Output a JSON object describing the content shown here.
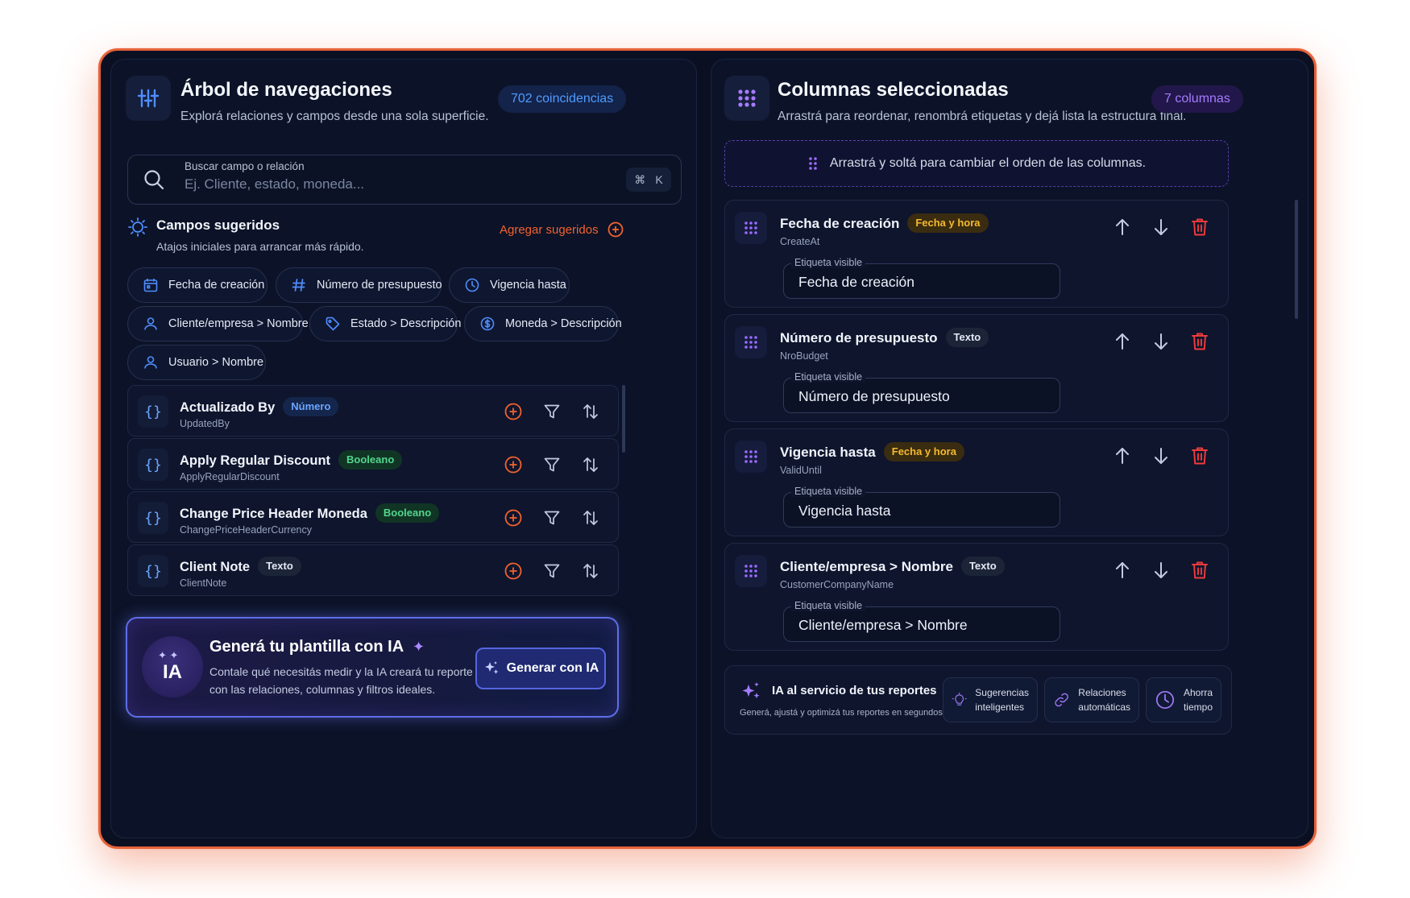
{
  "left": {
    "title": "Árbol de navegaciones",
    "subtitle": "Explorá relaciones y campos desde una sola superficie.",
    "match_count": "702 coincidencias",
    "search": {
      "label": "Buscar campo o relación",
      "placeholder": "Ej. Cliente, estado, moneda...",
      "shortcut_key": "K"
    },
    "suggested": {
      "title": "Campos sugeridos",
      "subtitle": "Atajos iniciales para arrancar más rápido.",
      "add_label": "Agregar sugeridos",
      "chips": [
        {
          "label": "Fecha de creación",
          "icon": "calendar-icon"
        },
        {
          "label": "Número de presupuesto",
          "icon": "hash-icon"
        },
        {
          "label": "Vigencia hasta",
          "icon": "clock-icon"
        },
        {
          "label": "Cliente/empresa > Nombre",
          "icon": "user-icon"
        },
        {
          "label": "Estado > Descripción",
          "icon": "tag-icon"
        },
        {
          "label": "Moneda > Descripción",
          "icon": "currency-icon"
        },
        {
          "label": "Usuario > Nombre",
          "icon": "user-icon"
        }
      ]
    },
    "fields": [
      {
        "name": "Actualizado By",
        "key": "UpdatedBy",
        "type": "Número"
      },
      {
        "name": "Apply Regular Discount",
        "key": "ApplyRegularDiscount",
        "type": "Booleano"
      },
      {
        "name": "Change Price Header Moneda",
        "key": "ChangePriceHeaderCurrency",
        "type": "Booleano"
      },
      {
        "name": "Client Note",
        "key": "ClientNote",
        "type": "Texto"
      }
    ],
    "ai": {
      "avatar": "IA",
      "title": "Generá tu plantilla con IA",
      "desc1": "Contale qué necesitás medir y la IA creará tu reporte",
      "desc2": "con las relaciones, columnas y filtros ideales.",
      "button": "Generar con IA"
    }
  },
  "right": {
    "title": "Columnas seleccionadas",
    "subtitle": "Arrastrá para reordenar, renombrá etiquetas y dejá lista la estructura final.",
    "count": "7 columnas",
    "dropzone": "Arrastrá y soltá para cambiar el orden de las columnas.",
    "visible_label_caption": "Etiqueta visible",
    "columns": [
      {
        "name": "Fecha de creación",
        "type": "Fecha y hora",
        "key": "CreateAt",
        "label": "Fecha de creación"
      },
      {
        "name": "Número de presupuesto",
        "type": "Texto",
        "key": "NroBudget",
        "label": "Número de presupuesto"
      },
      {
        "name": "Vigencia hasta",
        "type": "Fecha y hora",
        "key": "ValidUntil",
        "label": "Vigencia hasta"
      },
      {
        "name": "Cliente/empresa > Nombre",
        "type": "Texto",
        "key": "CustomerCompanyName",
        "label": "Cliente/empresa > Nombre"
      }
    ],
    "promo": {
      "title": "IA al servicio de tus reportes",
      "subtitle": "Generá, ajustá y optimizá tus reportes en segundos.",
      "tiles": [
        {
          "line1": "Sugerencias",
          "line2": "inteligentes"
        },
        {
          "line1": "Relaciones",
          "line2": "automáticas"
        },
        {
          "line1": "Ahorra",
          "line2": "tiempo"
        }
      ]
    }
  },
  "colors": {
    "accent_orange": "#f0622f",
    "accent_blue": "#4f8dff",
    "accent_purple": "#9b6bff",
    "danger": "#ef3b3b"
  }
}
